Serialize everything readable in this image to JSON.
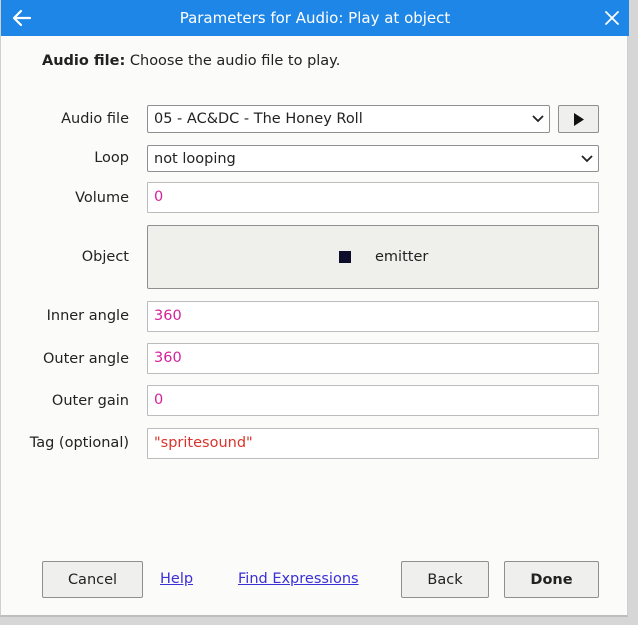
{
  "dialog": {
    "title": "Parameters for Audio: Play at object",
    "description_label": "Audio file:",
    "description_text": "Choose the audio file to play."
  },
  "fields": {
    "audio_file": {
      "label": "Audio file",
      "value": "05 - AC&DC - The Honey Roll"
    },
    "loop": {
      "label": "Loop",
      "value": "not looping"
    },
    "volume": {
      "label": "Volume",
      "value": "0"
    },
    "object": {
      "label": "Object",
      "value": "emitter"
    },
    "inner_angle": {
      "label": "Inner angle",
      "value": "360"
    },
    "outer_angle": {
      "label": "Outer angle",
      "value": "360"
    },
    "outer_gain": {
      "label": "Outer gain",
      "value": "0"
    },
    "tag": {
      "label": "Tag (optional)",
      "value": "\"spritesound\""
    }
  },
  "footer": {
    "cancel_label": "Cancel",
    "help_label": "Help",
    "find_expressions_label": "Find Expressions",
    "back_label": "Back",
    "done_label": "Done"
  },
  "icons": {
    "back": "arrow-left-icon",
    "close": "close-icon",
    "play": "play-icon",
    "chevron": "chevron-down-icon",
    "object": "sprite-swatch-icon"
  },
  "colors": {
    "title_bar": "#1e86e6",
    "number_value": "#d6219a",
    "string_value": "#d9342b",
    "link": "#3b2fd6",
    "object_swatch": "#0f0e2a"
  }
}
